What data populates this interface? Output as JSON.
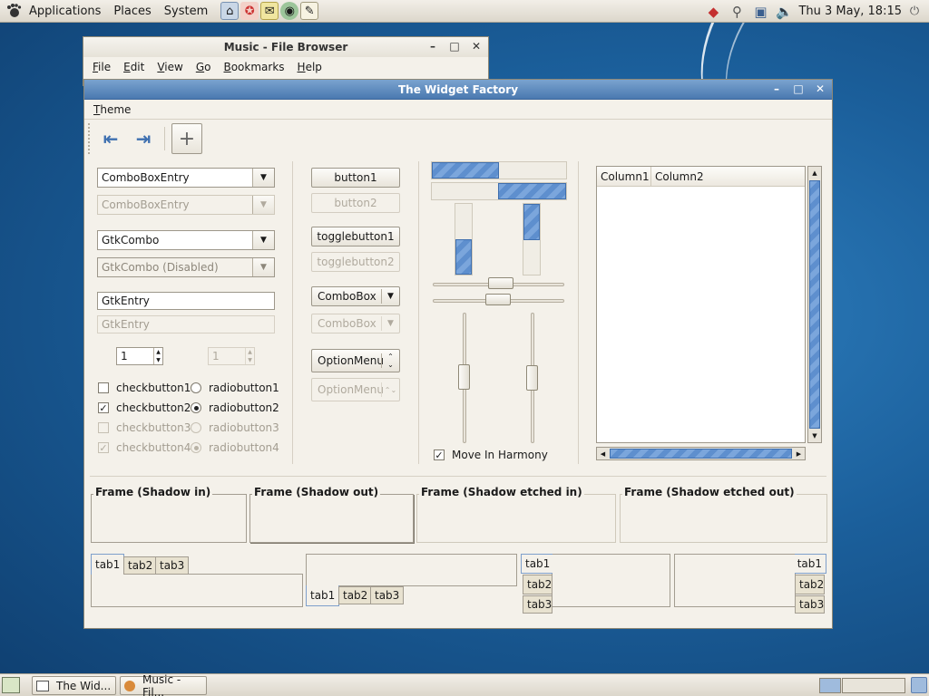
{
  "top_panel": {
    "menus": [
      "Applications",
      "Places",
      "System"
    ],
    "clock": "Thu  3 May, 18:15"
  },
  "music_window": {
    "title": "Music - File Browser",
    "menus": [
      "File",
      "Edit",
      "View",
      "Go",
      "Bookmarks",
      "Help"
    ]
  },
  "widget_factory": {
    "title": "The Widget Factory",
    "menu": "Theme",
    "left": {
      "combo_entry": "ComboBoxEntry",
      "combo_entry_disabled": "ComboBoxEntry",
      "gtk_combo": "GtkCombo",
      "gtk_combo_disabled": "GtkCombo (Disabled)",
      "entry": "GtkEntry",
      "entry_disabled": "GtkEntry",
      "spin_value": "1",
      "spin_disabled_value": "1",
      "checks": [
        "checkbutton1",
        "checkbutton2",
        "checkbutton3",
        "checkbutton4"
      ],
      "radios": [
        "radiobutton1",
        "radiobutton2",
        "radiobutton3",
        "radiobutton4"
      ]
    },
    "buttons": {
      "button1": "button1",
      "button2": "button2",
      "toggle1": "togglebutton1",
      "toggle2": "togglebutton2",
      "combobox": "ComboBox",
      "combobox_disabled": "ComboBox",
      "optionmenu": "OptionMenu",
      "optionmenu_disabled": "OptionMenu"
    },
    "move_in_harmony": "Move In Harmony",
    "tree": {
      "columns": [
        "Column1",
        "Column2"
      ]
    },
    "frames": [
      "Frame (Shadow in)",
      "Frame (Shadow out)",
      "Frame (Shadow etched in)",
      "Frame (Shadow etched out)"
    ],
    "tabs": [
      "tab1",
      "tab2",
      "tab3"
    ]
  },
  "taskbar": {
    "items": [
      "The Wid...",
      "Music - Fil..."
    ]
  },
  "colors": {
    "titlebar_active": "#4a79b0",
    "progress_fill": "#5e8fce",
    "window_bg": "#f4f1ea",
    "desktop": "#1b5f9b"
  }
}
